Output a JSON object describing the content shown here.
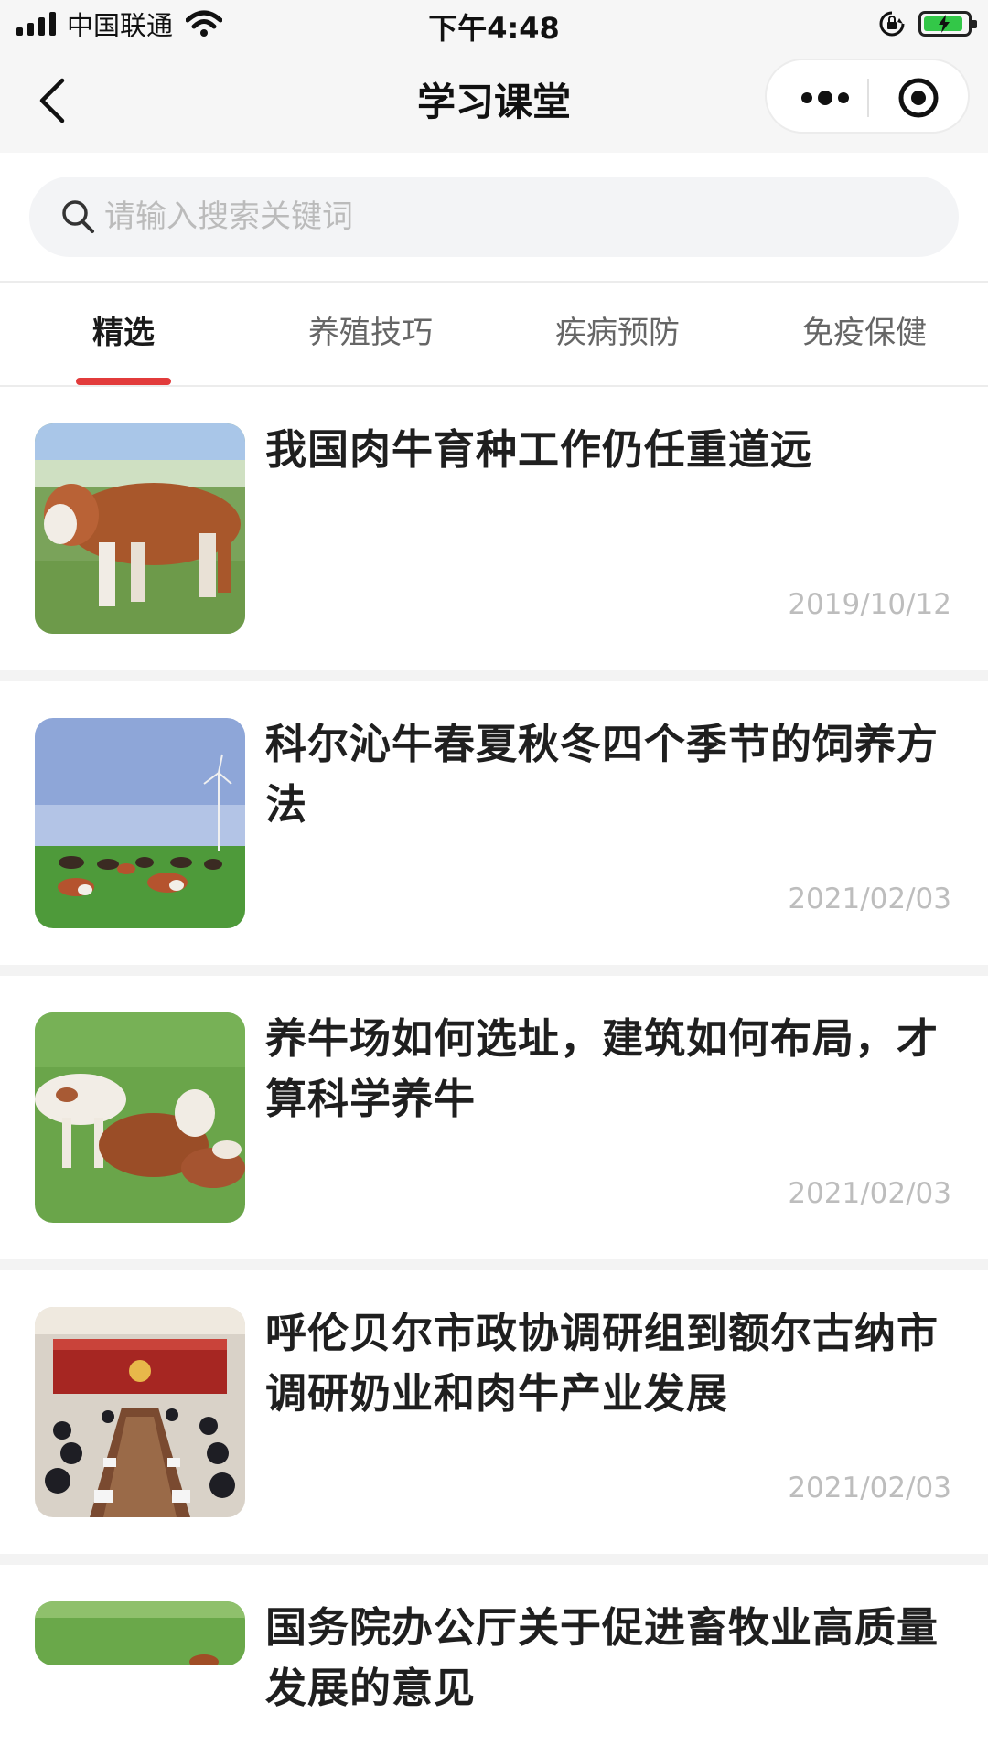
{
  "status_bar": {
    "carrier": "中国联通",
    "time": "下午4:48"
  },
  "nav": {
    "title": "学习课堂"
  },
  "search": {
    "placeholder": "请输入搜索关键词"
  },
  "tabs": [
    {
      "label": "精选",
      "active": true
    },
    {
      "label": "养殖技巧",
      "active": false
    },
    {
      "label": "疾病预防",
      "active": false
    },
    {
      "label": "免疫保健",
      "active": false
    }
  ],
  "articles": [
    {
      "title": "我国肉牛育种工作仍任重道远",
      "date": "2019/10/12"
    },
    {
      "title": "科尔沁牛春夏秋冬四个季节的饲养方法",
      "date": "2021/02/03"
    },
    {
      "title": "养牛场如何选址，建筑如何布局，才算科学养牛",
      "date": "2021/02/03"
    },
    {
      "title": "呼伦贝尔市政协调研组到额尔古纳市调研奶业和肉牛产业发展",
      "date": "2021/02/03"
    },
    {
      "title": "国务院办公厅关于促进畜牧业高质量发展的意见",
      "date": ""
    }
  ],
  "colors": {
    "accent": "#e23b3b",
    "battery": "#33c748"
  }
}
